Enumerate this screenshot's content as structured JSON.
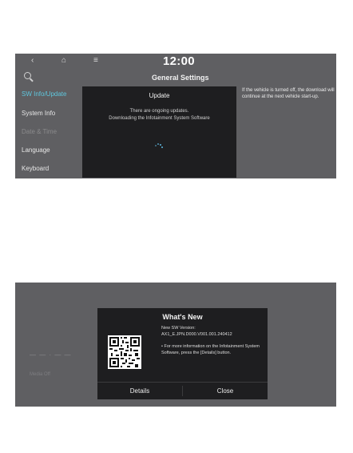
{
  "screen1": {
    "topbar": {
      "back_icon": "‹",
      "home_icon": "⌂",
      "menu_icon": "≡",
      "clock": "12:00"
    },
    "header_title": "General Settings",
    "sidebar": [
      {
        "label": "SW Info/Update",
        "state": "active"
      },
      {
        "label": "System Info",
        "state": "normal"
      },
      {
        "label": "Date & Time",
        "state": "disabled"
      },
      {
        "label": "Language",
        "state": "normal"
      },
      {
        "label": "Keyboard",
        "state": "normal"
      }
    ],
    "dialog": {
      "title": "Update",
      "message_line1": "There are ongoing updates.",
      "message_line2": "Downloading the Infotainment System Software"
    },
    "note": "If the vehicle is turned off, the download will continue at the next vehicle start-up.",
    "colors": {
      "accent": "#5fc6dd",
      "background": "#5f5f62",
      "dialog": "#1e1e20"
    }
  },
  "screen2": {
    "background_label": "Media Off",
    "dialog": {
      "title": "What's New",
      "version_label": "New SW Version:",
      "version_value": "AX1_E.JPN.D000.V001.001.240412",
      "info": "• For more information on the Infotainment System Software, press the [Details] button.",
      "details_button": "Details",
      "close_button": "Close"
    },
    "qr_icon": "qr-code"
  }
}
